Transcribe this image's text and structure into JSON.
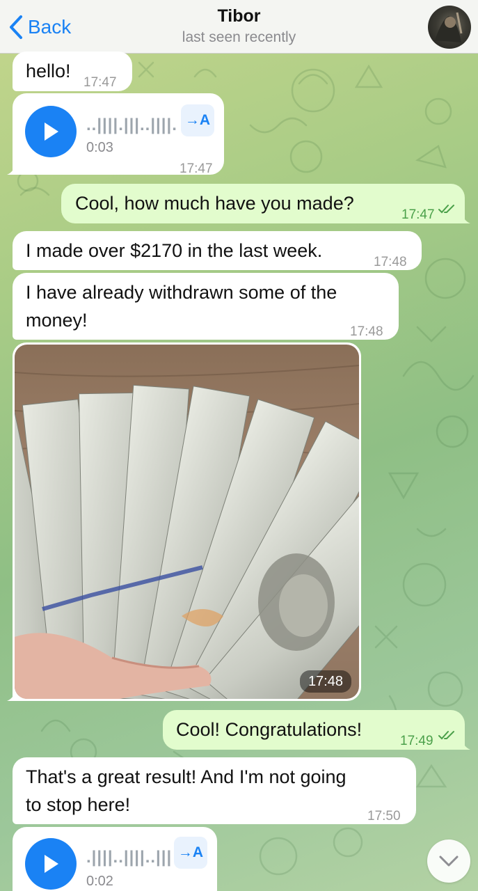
{
  "header": {
    "back_label": "Back",
    "contact_name": "Tibor",
    "status": "last seen recently"
  },
  "messages": [
    {
      "type": "text",
      "direction": "in",
      "text": "hello!",
      "time": "17:47"
    },
    {
      "type": "voice",
      "direction": "in",
      "duration": "0:03",
      "waveform": "..||||.|||..||||.",
      "transcribe_label": "→A",
      "time": "17:47"
    },
    {
      "type": "text",
      "direction": "out",
      "text": "Cool, how much have you made?",
      "time": "17:47"
    },
    {
      "type": "text",
      "direction": "in",
      "text": "I made over $2170 in the last week.",
      "time": "17:48"
    },
    {
      "type": "text",
      "direction": "in",
      "lines": [
        "I have already withdrawn some of the",
        "money!"
      ],
      "time": "17:48"
    },
    {
      "type": "photo",
      "direction": "in",
      "time": "17:48"
    },
    {
      "type": "text",
      "direction": "out",
      "text": "Cool! Congratulations!",
      "time": "17:49"
    },
    {
      "type": "text",
      "direction": "in",
      "lines": [
        "That's a great result! And I'm not going",
        "to stop here!"
      ],
      "time": "17:50"
    },
    {
      "type": "voice",
      "direction": "in",
      "duration": "0:02",
      "waveform": ".||||..||||..|||",
      "transcribe_label": "→A"
    }
  ],
  "colors": {
    "accent": "#1a82f4",
    "outgoing_bubble": "#e2fccd",
    "incoming_bubble": "#ffffff",
    "outgoing_time": "#4ba04a"
  },
  "icons": {
    "back": "chevron-left-icon",
    "play": "play-icon",
    "read_receipt": "double-check-icon",
    "scroll_down": "chevron-down-icon"
  }
}
